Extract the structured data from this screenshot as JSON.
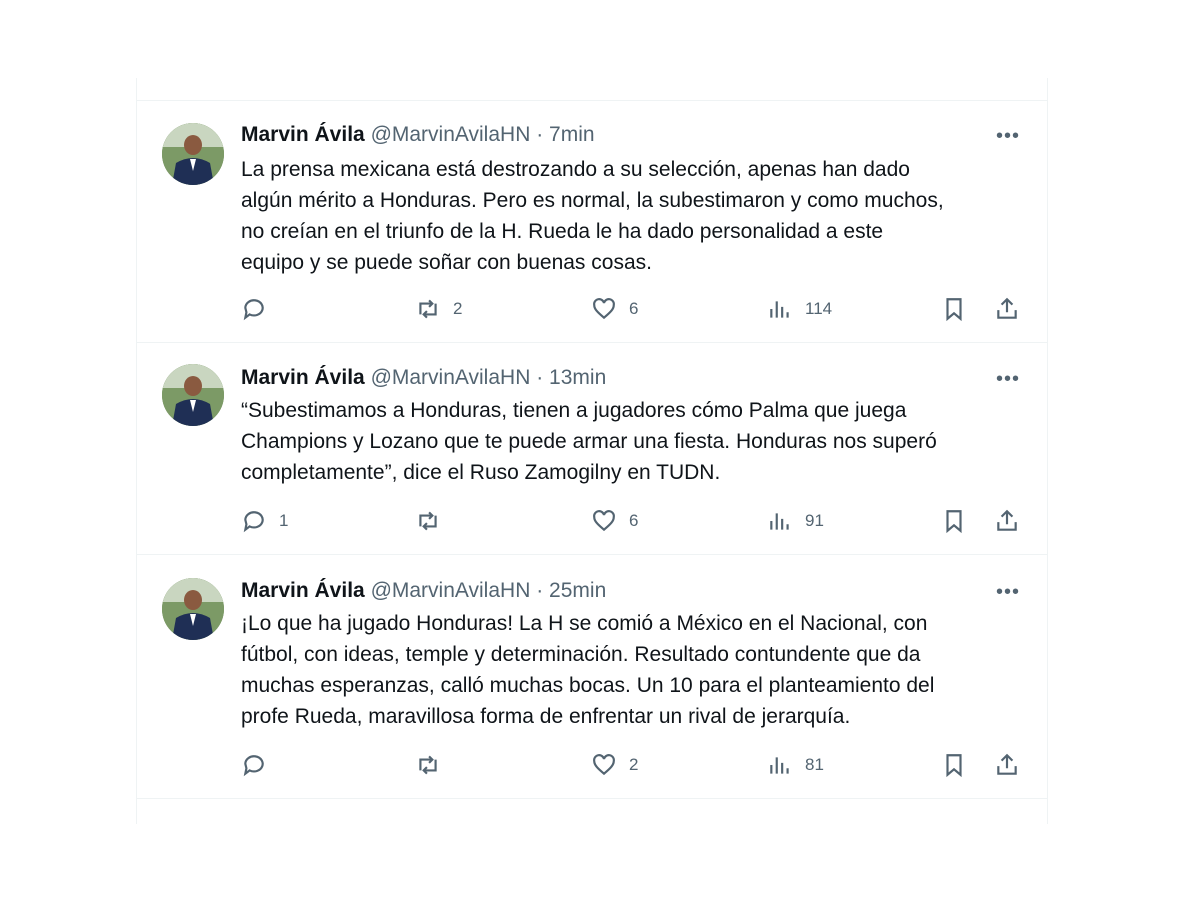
{
  "colors": {
    "text": "#0f1419",
    "secondary": "#536471",
    "border": "#eff3f4"
  },
  "tweets": [
    {
      "name": "Marvin Ávila",
      "handle": "@MarvinAvilaHN",
      "sep": "·",
      "time": "7min",
      "lines": [
        "La prensa mexicana está destrozando a su selección, apenas han dado",
        "algún mérito a Honduras. Pero es normal, la subestimaron y como muchos,",
        "no creían en el triunfo de la H. Rueda le ha dado personalidad a este",
        "equipo y se puede soñar con buenas cosas."
      ],
      "replies": "",
      "retweets": "2",
      "likes": "6",
      "views": "114"
    },
    {
      "name": "Marvin Ávila",
      "handle": "@MarvinAvilaHN",
      "sep": "·",
      "time": "13min",
      "lines": [
        "“Subestimamos a Honduras, tienen a jugadores cómo Palma que juega",
        "Champions y Lozano que te puede armar una fiesta. Honduras nos superó",
        "completamente”, dice el Ruso Zamogilny en TUDN."
      ],
      "replies": "1",
      "retweets": "",
      "likes": "6",
      "views": "91"
    },
    {
      "name": "Marvin Ávila",
      "handle": "@MarvinAvilaHN",
      "sep": "·",
      "time": "25min",
      "lines": [
        "¡Lo que ha jugado Honduras! La H se comió a México en el Nacional, con",
        "fútbol, con ideas, temple y determinación. Resultado contundente que da",
        "muchas esperanzas, calló muchas bocas. Un 10 para el planteamiento del",
        "profe Rueda, maravillosa forma de enfrentar un rival de jerarquía."
      ],
      "replies": "",
      "retweets": "",
      "likes": "2",
      "views": "81"
    }
  ],
  "icons": {
    "reply": "reply-icon",
    "retweet": "retweet-icon",
    "like": "heart-icon",
    "views": "views-icon",
    "bookmark": "bookmark-icon",
    "share": "share-icon",
    "more": "more-icon"
  }
}
